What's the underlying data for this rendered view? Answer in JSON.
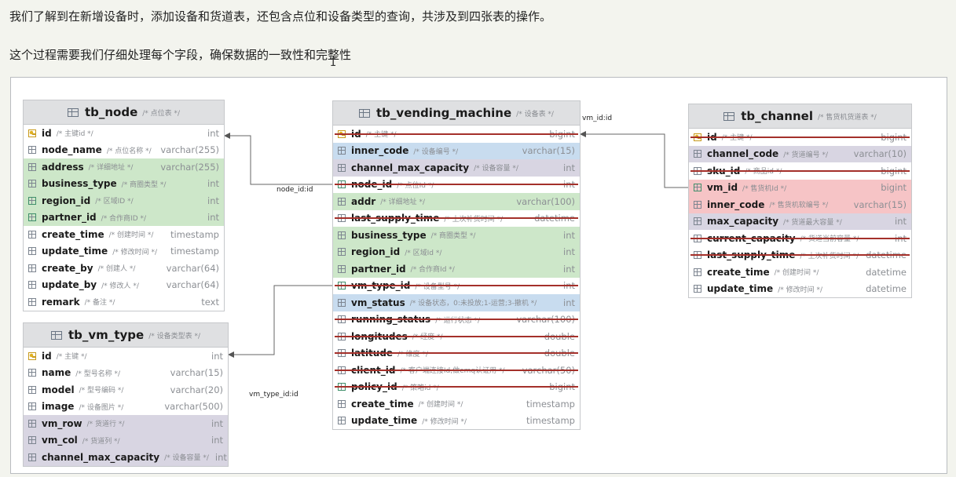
{
  "intro": {
    "line1": "我们了解到在新增设备时，添加设备和货道表，还包含点位和设备类型的查询，共涉及到四张表的操作。",
    "line2": "这个过程需要我们仔细处理每个字段，确保数据的一致性和完整性",
    "cursor": "I"
  },
  "colors": {
    "green": "#cde7c9",
    "blue": "#c8dcef",
    "purple": "#d8d5e2",
    "pink": "#f6c4c6",
    "strike": "#a4302a",
    "header": "#dfe0e2"
  },
  "links": {
    "node_label": "node_id:id",
    "vm_type_label": "vm_type_id:id",
    "vm_label": "vm_id:id"
  },
  "tables": {
    "tb_node": {
      "name": "tb_node",
      "comment": "/* 点位表 */",
      "columns": [
        {
          "name": "id",
          "comment": "/* 主键id */",
          "type": "int",
          "icon": "key",
          "color": "",
          "strike": false
        },
        {
          "name": "node_name",
          "comment": "/* 点位名称 */",
          "type": "varchar(255)",
          "icon": "col",
          "color": "",
          "strike": false
        },
        {
          "name": "address",
          "comment": "/* 详细地址 */",
          "type": "varchar(255)",
          "icon": "col",
          "color": "green",
          "strike": false
        },
        {
          "name": "business_type",
          "comment": "/* 商圈类型 */",
          "type": "int",
          "icon": "col",
          "color": "green",
          "strike": false
        },
        {
          "name": "region_id",
          "comment": "/* 区域ID */",
          "type": "int",
          "icon": "fk",
          "color": "green",
          "strike": false
        },
        {
          "name": "partner_id",
          "comment": "/* 合作商ID */",
          "type": "int",
          "icon": "fk",
          "color": "green",
          "strike": false
        },
        {
          "name": "create_time",
          "comment": "/* 创建时间 */",
          "type": "timestamp",
          "icon": "col",
          "color": "",
          "strike": false
        },
        {
          "name": "update_time",
          "comment": "/* 修改时间 */",
          "type": "timestamp",
          "icon": "col",
          "color": "",
          "strike": false
        },
        {
          "name": "create_by",
          "comment": "/* 创建人 */",
          "type": "varchar(64)",
          "icon": "col",
          "color": "",
          "strike": false
        },
        {
          "name": "update_by",
          "comment": "/* 修改人 */",
          "type": "varchar(64)",
          "icon": "col",
          "color": "",
          "strike": false
        },
        {
          "name": "remark",
          "comment": "/* 备注 */",
          "type": "text",
          "icon": "col",
          "color": "",
          "strike": false
        }
      ]
    },
    "tb_vm_type": {
      "name": "tb_vm_type",
      "comment": "/* 设备类型表 */",
      "columns": [
        {
          "name": "id",
          "comment": "/* 主键 */",
          "type": "int",
          "icon": "key",
          "color": "",
          "strike": false
        },
        {
          "name": "name",
          "comment": "/* 型号名称 */",
          "type": "varchar(15)",
          "icon": "col",
          "color": "",
          "strike": false
        },
        {
          "name": "model",
          "comment": "/* 型号编码 */",
          "type": "varchar(20)",
          "icon": "col",
          "color": "",
          "strike": false
        },
        {
          "name": "image",
          "comment": "/* 设备图片 */",
          "type": "varchar(500)",
          "icon": "col",
          "color": "",
          "strike": false
        },
        {
          "name": "vm_row",
          "comment": "/* 货道行 */",
          "type": "int",
          "icon": "col",
          "color": "purple",
          "strike": false
        },
        {
          "name": "vm_col",
          "comment": "/* 货道列 */",
          "type": "int",
          "icon": "col",
          "color": "purple",
          "strike": false
        },
        {
          "name": "channel_max_capacity",
          "comment": "/* 设备容量 */",
          "type": "int",
          "icon": "col",
          "color": "purple",
          "strike": false
        }
      ]
    },
    "tb_vending_machine": {
      "name": "tb_vending_machine",
      "comment": "/* 设备表 */",
      "columns": [
        {
          "name": "id",
          "comment": "/* 主键 */",
          "type": "bigint",
          "icon": "key",
          "color": "",
          "strike": true
        },
        {
          "name": "inner_code",
          "comment": "/* 设备编号 */",
          "type": "varchar(15)",
          "icon": "col",
          "color": "blue",
          "strike": false
        },
        {
          "name": "channel_max_capacity",
          "comment": "/* 设备容量 */",
          "type": "int",
          "icon": "col",
          "color": "purple",
          "strike": false
        },
        {
          "name": "node_id",
          "comment": "/* 点位Id */",
          "type": "int",
          "icon": "fk",
          "color": "",
          "strike": true
        },
        {
          "name": "addr",
          "comment": "/* 详细地址 */",
          "type": "varchar(100)",
          "icon": "col",
          "color": "green",
          "strike": false
        },
        {
          "name": "last_supply_time",
          "comment": "/* 上次补货时间 */",
          "type": "datetime",
          "icon": "col",
          "color": "",
          "strike": true
        },
        {
          "name": "business_type",
          "comment": "/* 商圈类型 */",
          "type": "int",
          "icon": "col",
          "color": "green",
          "strike": false
        },
        {
          "name": "region_id",
          "comment": "/* 区域Id */",
          "type": "int",
          "icon": "col",
          "color": "green",
          "strike": false
        },
        {
          "name": "partner_id",
          "comment": "/* 合作商Id */",
          "type": "int",
          "icon": "col",
          "color": "green",
          "strike": false
        },
        {
          "name": "vm_type_id",
          "comment": "/* 设备型号 */",
          "type": "int",
          "icon": "fk",
          "color": "",
          "strike": true
        },
        {
          "name": "vm_status",
          "comment": "/* 设备状态，0:未投放;1-运营;3-撤机 */",
          "type": "int",
          "icon": "col",
          "color": "blue",
          "strike": false
        },
        {
          "name": "running_status",
          "comment": "/* 运行状态 */",
          "type": "varchar(100)",
          "icon": "col",
          "color": "",
          "strike": true
        },
        {
          "name": "longitudes",
          "comment": "/* 经度 */",
          "type": "double",
          "icon": "col",
          "color": "",
          "strike": true
        },
        {
          "name": "latitude",
          "comment": "/* 维度 */",
          "type": "double",
          "icon": "col",
          "color": "",
          "strike": true
        },
        {
          "name": "client_id",
          "comment": "/* 客户端连接Id,做emq认证用 */",
          "type": "varchar(50)",
          "icon": "col",
          "color": "",
          "strike": true
        },
        {
          "name": "policy_id",
          "comment": "/* 策略id */",
          "type": "bigint",
          "icon": "fk",
          "color": "",
          "strike": true
        },
        {
          "name": "create_time",
          "comment": "/* 创建时间 */",
          "type": "timestamp",
          "icon": "col",
          "color": "",
          "strike": false
        },
        {
          "name": "update_time",
          "comment": "/* 修改时间 */",
          "type": "timestamp",
          "icon": "col",
          "color": "",
          "strike": false
        }
      ]
    },
    "tb_channel": {
      "name": "tb_channel",
      "comment": "/* 售货机货道表 */",
      "columns": [
        {
          "name": "id",
          "comment": "/* 主键 */",
          "type": "bigint",
          "icon": "key",
          "color": "",
          "strike": true
        },
        {
          "name": "channel_code",
          "comment": "/* 货道编号 */",
          "type": "varchar(10)",
          "icon": "col",
          "color": "purple",
          "strike": false
        },
        {
          "name": "sku_id",
          "comment": "/* 商品id */",
          "type": "bigint",
          "icon": "col",
          "color": "",
          "strike": true
        },
        {
          "name": "vm_id",
          "comment": "/* 售货机Id */",
          "type": "bigint",
          "icon": "fk",
          "color": "pink",
          "strike": false
        },
        {
          "name": "inner_code",
          "comment": "/* 售货机软编号 */",
          "type": "varchar(15)",
          "icon": "col",
          "color": "pink",
          "strike": false
        },
        {
          "name": "max_capacity",
          "comment": "/* 货道最大容量 */",
          "type": "int",
          "icon": "col",
          "color": "purple",
          "strike": false
        },
        {
          "name": "current_capacity",
          "comment": "/* 货道当前容量 */",
          "type": "int",
          "icon": "col",
          "color": "",
          "strike": true
        },
        {
          "name": "last_supply_time",
          "comment": "/* 上次补货时间 */",
          "type": "datetime",
          "icon": "col",
          "color": "",
          "strike": true
        },
        {
          "name": "create_time",
          "comment": "/* 创建时间 */",
          "type": "datetime",
          "icon": "col",
          "color": "",
          "strike": false
        },
        {
          "name": "update_time",
          "comment": "/* 修改时间 */",
          "type": "datetime",
          "icon": "col",
          "color": "",
          "strike": false
        }
      ]
    }
  }
}
